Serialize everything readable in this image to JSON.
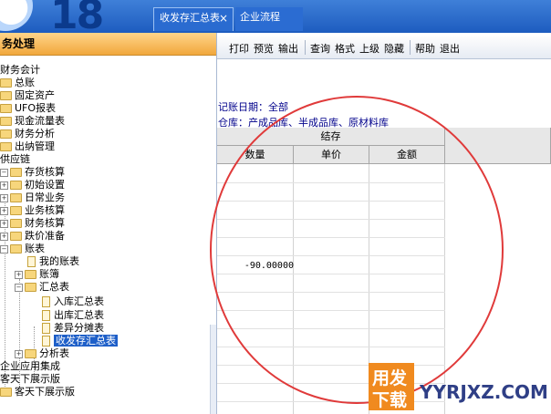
{
  "app": {
    "logo_text": "18"
  },
  "tabs": [
    {
      "label": "收发存汇总表",
      "close": "×"
    },
    {
      "label": "企业流程"
    }
  ],
  "left_panel": {
    "title": "务处理",
    "tree": [
      {
        "label": "财务会计"
      },
      {
        "label": "总账"
      },
      {
        "label": "固定资产"
      },
      {
        "label": "UFO报表"
      },
      {
        "label": "现金流量表"
      },
      {
        "label": "财务分析"
      },
      {
        "label": "出纳管理"
      },
      {
        "label": "供应链"
      },
      {
        "label": "存货核算"
      },
      {
        "label": "初始设置"
      },
      {
        "label": "日常业务"
      },
      {
        "label": "业务核算"
      },
      {
        "label": "财务核算"
      },
      {
        "label": "跌价准备"
      },
      {
        "label": "账表"
      },
      {
        "label": "我的账表"
      },
      {
        "label": "账簿"
      },
      {
        "label": "汇总表"
      },
      {
        "label": "入库汇总表"
      },
      {
        "label": "出库汇总表"
      },
      {
        "label": "差异分摊表"
      },
      {
        "label": "收发存汇总表"
      },
      {
        "label": "分析表"
      },
      {
        "label": "企业应用集成"
      },
      {
        "label": "客天下展示版"
      },
      {
        "label": "客天下展示版"
      }
    ]
  },
  "toolbar": [
    "打印",
    "预览",
    "输出",
    "查询",
    "格式",
    "上级",
    "隐藏",
    "帮助",
    "退出"
  ],
  "report": {
    "date_line": "记账日期：全部",
    "warehouse_line": "仓库：产成品库、半成品库、原材料库",
    "group_header": "结存",
    "columns": [
      "数量",
      "单价",
      "金额"
    ],
    "value": "-90.00000"
  },
  "watermark": {
    "line1": "用发",
    "line2": "下载",
    "site": "YYRJXZ.COM"
  }
}
